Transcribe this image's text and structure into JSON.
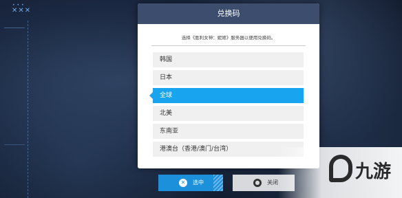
{
  "corner": {
    "icons": "✕✕✕",
    "dots": "•••"
  },
  "dialog": {
    "title": "兑换码",
    "description": "选择《胜利女神：妮姬》服务器以便用兑换码。",
    "servers": [
      "韩国",
      "日本",
      "全球",
      "北美",
      "东南亚",
      "港澳台（香港/澳门/台湾）"
    ],
    "selected_index": 2
  },
  "buttons": {
    "confirm": {
      "label": "选中",
      "icon": "✕"
    },
    "close": {
      "label": "关闭",
      "icon": "●"
    }
  },
  "watermark": {
    "text": "九游"
  },
  "colors": {
    "accent": "#19a4f0",
    "header": "#3c4d6e",
    "confirm": "#1d90dc"
  }
}
